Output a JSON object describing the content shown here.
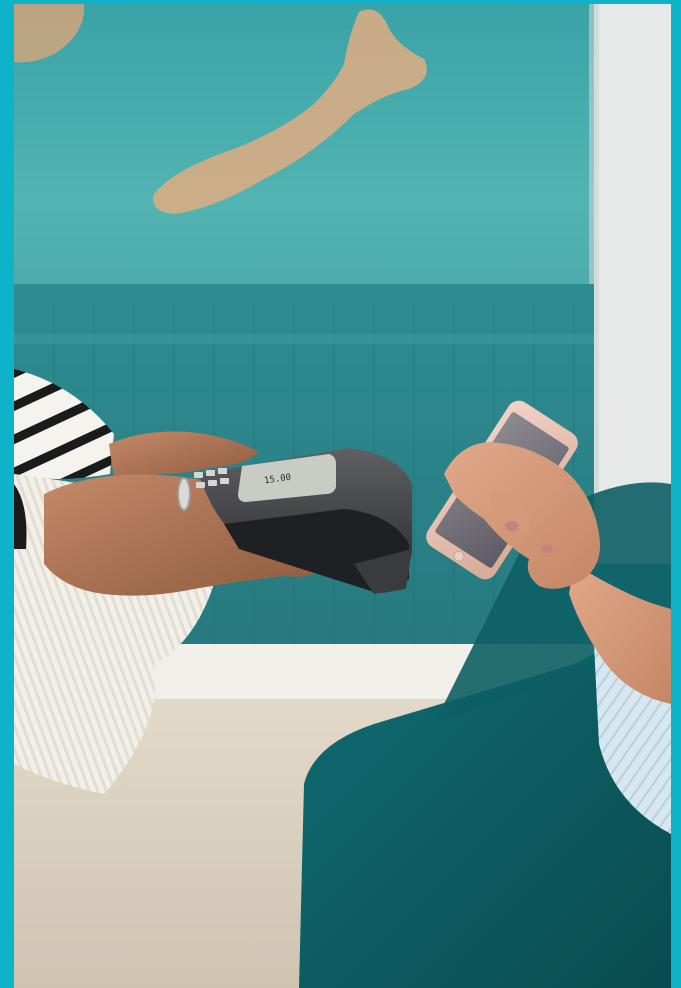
{
  "frame": {
    "border_color": "#0fb3c9"
  },
  "scene": {
    "wall_mural_color": "#43a9ab",
    "wall_panel_color": "#2c878c",
    "floor_color": "#d8cfc0",
    "sofa_color": "#0c5a60",
    "pos_screen_amount": "15.00",
    "phone_color": "#e8c2b3"
  }
}
